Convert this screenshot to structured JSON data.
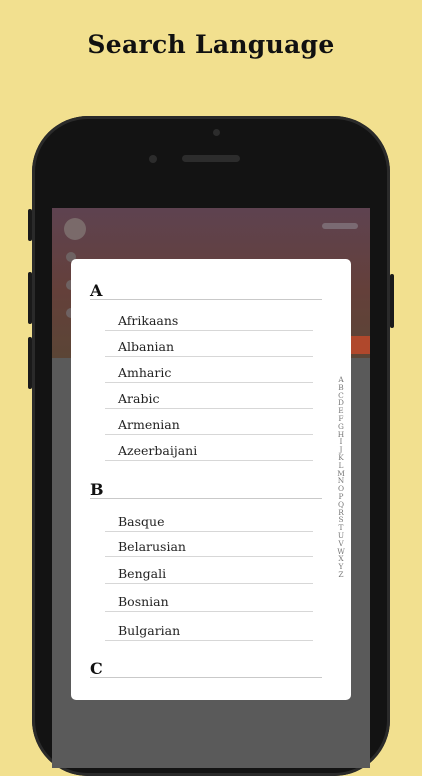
{
  "headline": "Search Language",
  "sections": [
    {
      "letter": "A",
      "items": [
        "Afrikaans",
        "Albanian",
        "Amharic",
        "Arabic",
        "Armenian",
        "Azeerbaijani"
      ]
    },
    {
      "letter": "B",
      "items": [
        "Basque",
        "Belarusian",
        "Bengali",
        "Bosnian",
        "Bulgarian"
      ]
    },
    {
      "letter": "C",
      "items": []
    }
  ],
  "index": [
    "A",
    "B",
    "C",
    "D",
    "E",
    "F",
    "G",
    "H",
    "I",
    "J",
    "K",
    "L",
    "M",
    "N",
    "O",
    "P",
    "Q",
    "R",
    "S",
    "T",
    "U",
    "V",
    "W",
    "X",
    "Y",
    "Z"
  ],
  "colors": {
    "background": "#f2e08f",
    "phone": "#131313",
    "modal": "#ffffff",
    "accent": "#b0482c"
  }
}
